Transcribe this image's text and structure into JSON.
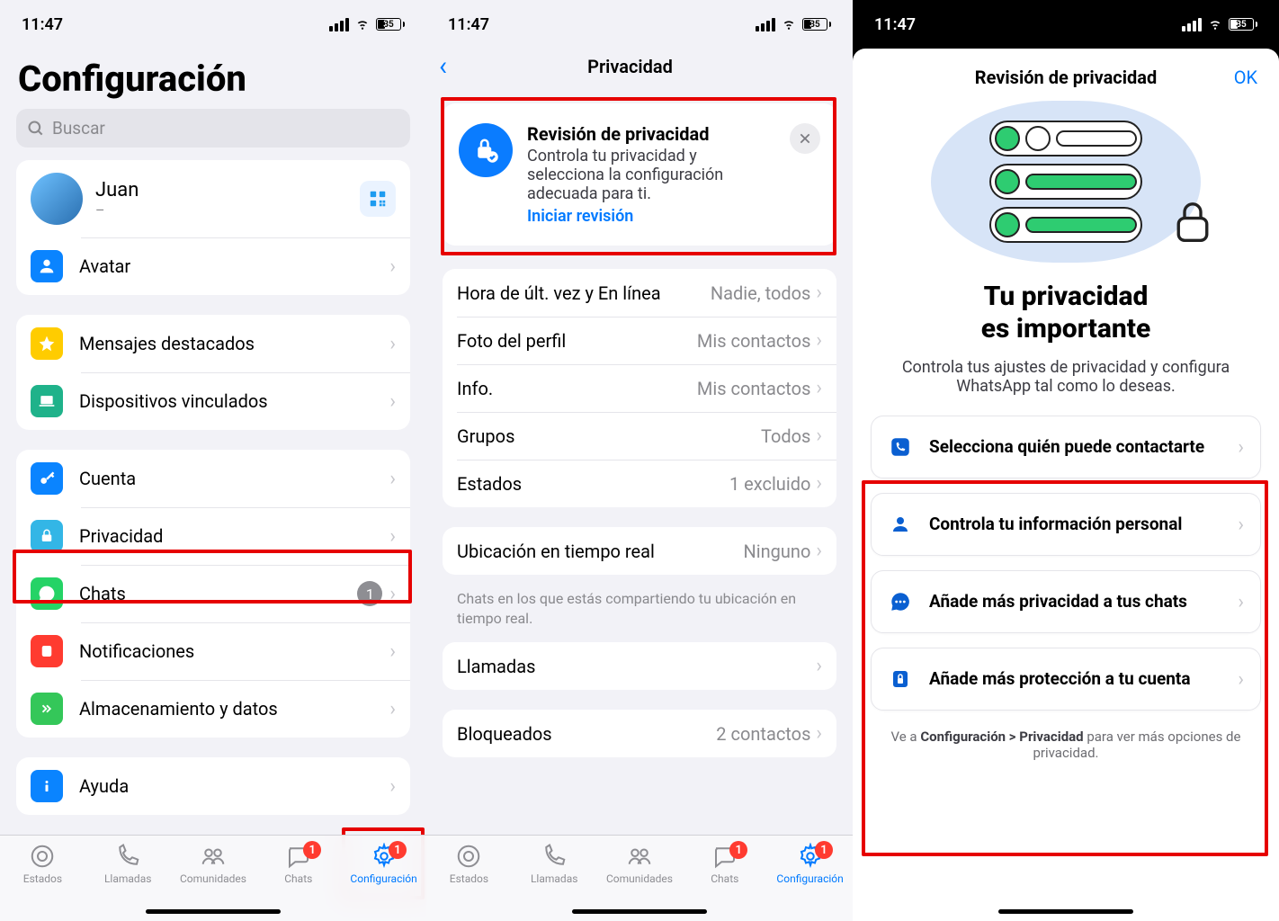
{
  "status": {
    "time": "11:47",
    "battery": "35"
  },
  "screen1": {
    "title": "Configuración",
    "search_placeholder": "Buscar",
    "profile": {
      "name": "Juan",
      "sub": "–"
    },
    "rows": {
      "avatar": "Avatar",
      "starred": "Mensajes destacados",
      "linked": "Dispositivos vinculados",
      "account": "Cuenta",
      "privacy": "Privacidad",
      "chats": "Chats",
      "chats_badge": "1",
      "notifications": "Notificaciones",
      "storage": "Almacenamiento y datos",
      "help": "Ayuda"
    }
  },
  "screen2": {
    "title": "Privacidad",
    "promo": {
      "title": "Revisión de privacidad",
      "text": "Controla tu privacidad y selecciona la configuración adecuada para ti.",
      "link": "Iniciar revisión"
    },
    "rows": {
      "lastseen": {
        "label": "Hora de últ. vez y En línea",
        "value": "Nadie, todos"
      },
      "photo": {
        "label": "Foto del perfil",
        "value": "Mis contactos"
      },
      "info": {
        "label": "Info.",
        "value": "Mis contactos"
      },
      "groups": {
        "label": "Grupos",
        "value": "Todos"
      },
      "status": {
        "label": "Estados",
        "value": "1 excluido"
      },
      "location": {
        "label": "Ubicación en tiempo real",
        "value": "Ninguno"
      },
      "location_foot": "Chats en los que estás compartiendo tu ubicación en tiempo real.",
      "calls": {
        "label": "Llamadas",
        "value": ""
      },
      "blocked": {
        "label": "Bloqueados",
        "value": "2 contactos"
      }
    }
  },
  "screen3": {
    "title": "Revisión de privacidad",
    "ok": "OK",
    "headline1": "Tu privacidad",
    "headline2": "es importante",
    "sub": "Controla tus ajustes de privacidad y configura WhatsApp tal como lo deseas.",
    "opts": {
      "o1": "Selecciona quién puede contactarte",
      "o2": "Controla tu información personal",
      "o3": "Añade más privacidad a tus chats",
      "o4": "Añade más protección a tu cuenta"
    },
    "foot_pre": "Ve a ",
    "foot_bold": "Configuración > Privacidad",
    "foot_post": " para ver más opciones de privacidad."
  },
  "tabs": {
    "t1": "Estados",
    "t2": "Llamadas",
    "t3": "Comunidades",
    "t4": "Chats",
    "t5": "Configuración",
    "badge_chats": "1",
    "badge_config": "1"
  }
}
